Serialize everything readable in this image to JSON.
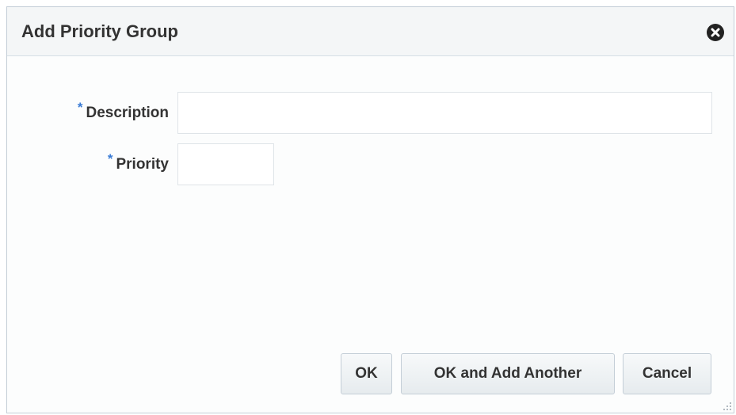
{
  "dialog": {
    "title": "Add Priority Group",
    "close_icon": "close-circle-icon"
  },
  "form": {
    "required_marker": "*",
    "fields": [
      {
        "label": "Description",
        "value": "",
        "placeholder": ""
      },
      {
        "label": "Priority",
        "value": "",
        "placeholder": ""
      }
    ]
  },
  "buttons": {
    "ok": "OK",
    "ok_add_another": "OK and Add Another",
    "cancel": "Cancel"
  },
  "colors": {
    "required_marker": "#3a7bd5",
    "close_icon_bg": "#222222"
  }
}
